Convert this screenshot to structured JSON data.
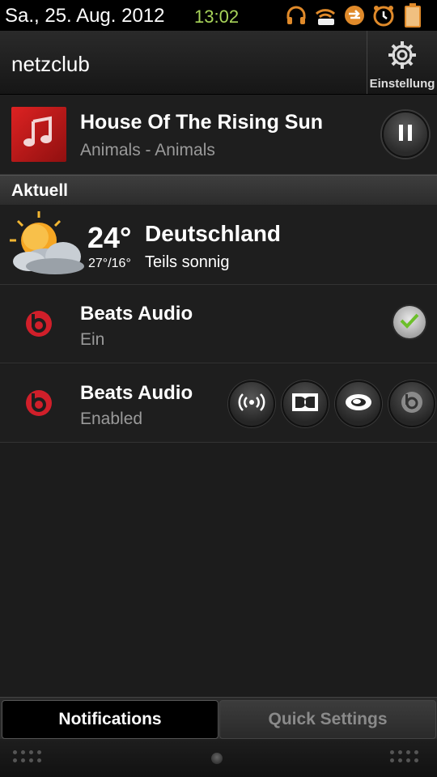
{
  "status_bar": {
    "date": "Sa., 25. Aug. 2012",
    "time": "13:02",
    "time_color": "#a8d45a",
    "icons": [
      "headphones-icon",
      "wifi-icon",
      "sync-icon",
      "alarm-icon",
      "battery-icon"
    ],
    "battery_level": "100"
  },
  "header": {
    "operator": "netzclub",
    "settings_label": "Einstellung"
  },
  "music": {
    "title": "House Of The Rising Sun",
    "subtitle": "Animals - Animals",
    "album_color": "#cc1a1a"
  },
  "section": {
    "label": "Aktuell"
  },
  "weather": {
    "temp": "24°",
    "range": "27°/16°",
    "location": "Deutschland",
    "condition": "Teils sonnig"
  },
  "beats_rows": [
    {
      "title": "Beats Audio",
      "status": "Ein"
    },
    {
      "title": "Beats Audio",
      "status": "Enabled"
    }
  ],
  "beats_color": "#d01f2a",
  "effects": [
    "surround-icon",
    "dolby-icon",
    "srs-icon",
    "beats-icon"
  ],
  "tabs": {
    "notifications": "Notifications",
    "quick_settings": "Quick Settings",
    "active": "notifications"
  }
}
